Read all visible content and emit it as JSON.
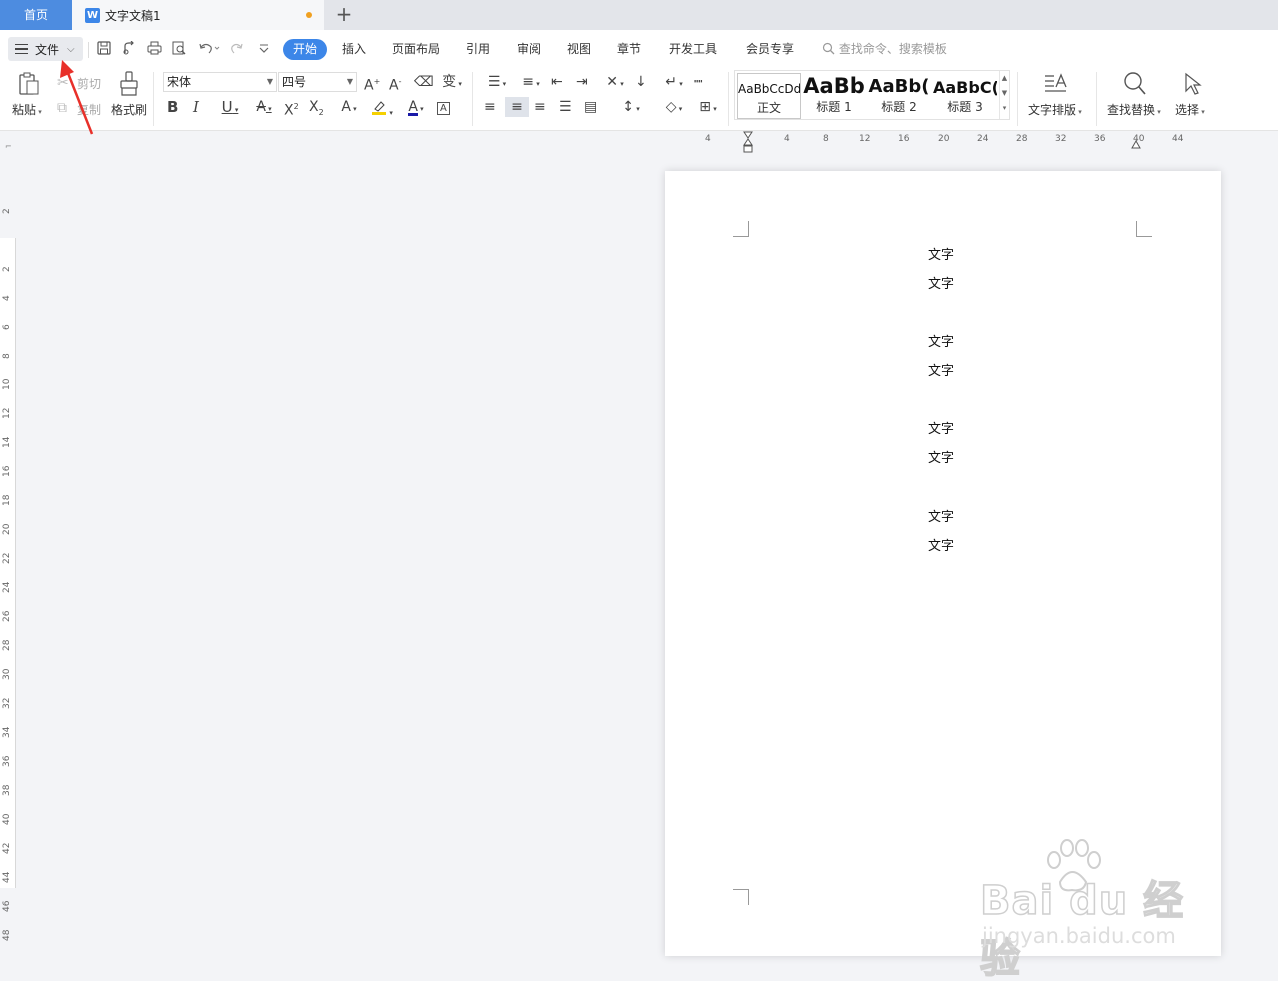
{
  "tabs": {
    "home": "首页",
    "document": "文字文稿1",
    "document_icon": "W",
    "add": "+"
  },
  "menu": {
    "file": "文件",
    "tabs": [
      "开始",
      "插入",
      "页面布局",
      "引用",
      "审阅",
      "视图",
      "章节",
      "开发工具",
      "会员专享"
    ],
    "active_tab": "开始",
    "search_placeholder": "查找命令、搜索模板"
  },
  "ribbon": {
    "paste": "粘贴",
    "cut": "剪切",
    "copy": "复制",
    "format_painter": "格式刷",
    "font_name": "宋体",
    "font_size": "四号",
    "styles": [
      {
        "preview": "AaBbCcDd",
        "name": "正文"
      },
      {
        "preview": "AaBb",
        "name": "标题 1"
      },
      {
        "preview": "AaBb(",
        "name": "标题 2"
      },
      {
        "preview": "AaBbC(",
        "name": "标题 3"
      }
    ],
    "text_layout": "文字排版",
    "find_replace": "查找替换",
    "select": "选择"
  },
  "ruler": {
    "horizontal": [
      "4",
      "4",
      "8",
      "12",
      "16",
      "20",
      "24",
      "28",
      "32",
      "36",
      "40",
      "44"
    ],
    "vertical": [
      "2",
      "2",
      "4",
      "6",
      "8",
      "10",
      "12",
      "14",
      "16",
      "18",
      "20",
      "22",
      "24",
      "26",
      "28",
      "30",
      "32",
      "34",
      "36",
      "38",
      "40",
      "42",
      "44",
      "46",
      "48"
    ]
  },
  "document": {
    "lines": [
      "文字",
      "文字",
      "文字",
      "文字",
      "文字",
      "文字",
      "文字",
      "文字"
    ]
  },
  "watermark": {
    "brand": "Bai du 经验",
    "url": "jingyan.baidu.com"
  },
  "colors": {
    "accent": "#3c86e8",
    "home_tab": "#4d8ce0",
    "highlight": "#f5d000",
    "font_color": "#1a1aa8",
    "arrow": "#e8302a"
  }
}
